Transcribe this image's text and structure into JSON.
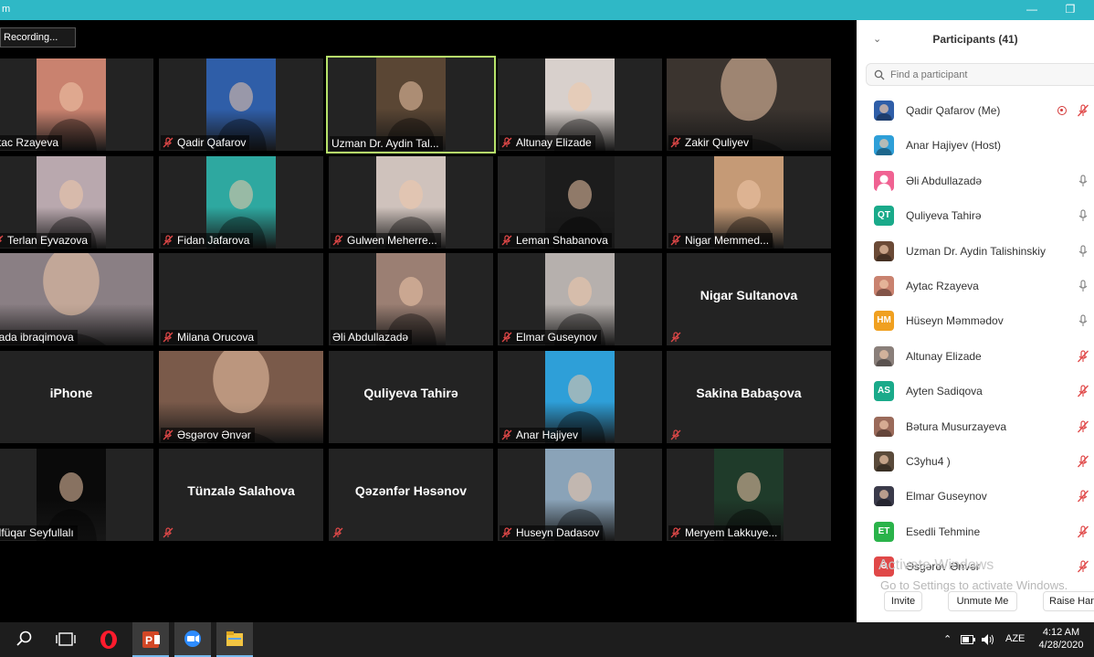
{
  "titlebar": {
    "title": "m",
    "minimize": "—",
    "restore": "❐"
  },
  "recording": {
    "label": "Recording..."
  },
  "tiles": [
    {
      "name": "ytac Rzayeva",
      "kind": "photo",
      "muted": false,
      "bg": "#c9826f"
    },
    {
      "name": "Qadir Qafarov",
      "kind": "photo",
      "muted": true,
      "bg": "#2f5ea8"
    },
    {
      "name": "Uzman Dr. Aydin Tal...",
      "kind": "photo",
      "muted": false,
      "bg": "#5a4634",
      "active": true
    },
    {
      "name": "Altunay Elizade",
      "kind": "photo",
      "muted": true,
      "bg": "#d8d0cc"
    },
    {
      "name": "Zakir Quliyev",
      "kind": "photofull",
      "muted": true,
      "bg": "#3b342f"
    },
    {
      "name": "Terlan Eyvazova",
      "kind": "photo",
      "muted": true,
      "bg": "#b9a8ae"
    },
    {
      "name": "Fidan Jafarova",
      "kind": "photo",
      "muted": true,
      "bg": "#2ea8a0"
    },
    {
      "name": "Gulwen Meherre...",
      "kind": "photo",
      "muted": true,
      "bg": "#cfc2bc"
    },
    {
      "name": "Leman Shabanova",
      "kind": "photo",
      "muted": true,
      "bg": "#1c1c1c"
    },
    {
      "name": "Nigar Memmed...",
      "kind": "photo",
      "muted": true,
      "bg": "#c59a76"
    },
    {
      "name": "irada ibraqimova",
      "kind": "photofull",
      "muted": false,
      "bg": "#8a7f84"
    },
    {
      "name": "Milana Orucova",
      "kind": "blank",
      "muted": true,
      "bg": "#000000"
    },
    {
      "name": "Əli Abdullazadə",
      "kind": "photo",
      "muted": false,
      "bg": "#9b7f73"
    },
    {
      "name": "Elmar Guseynov",
      "kind": "photo",
      "muted": true,
      "bg": "#b6b0ad"
    },
    {
      "name": "Nigar Sultanova",
      "kind": "text",
      "muted": true,
      "bg": "#232323"
    },
    {
      "name": "iPhone",
      "kind": "text",
      "muted": false,
      "bg": "#232323"
    },
    {
      "name": "Əsgərov Ənvər",
      "kind": "photofull",
      "muted": true,
      "bg": "#7a5a4a"
    },
    {
      "name": "Quliyeva Tahirə",
      "kind": "text",
      "muted": false,
      "bg": "#232323"
    },
    {
      "name": "Anar Hajiyev",
      "kind": "photo",
      "muted": true,
      "bg": "#2e9fd8"
    },
    {
      "name": "Sakina Babaşova",
      "kind": "text",
      "muted": true,
      "bg": "#232323"
    },
    {
      "name": "ülfüqar Seyfullalı",
      "kind": "photo",
      "muted": false,
      "bg": "#0a0a0a"
    },
    {
      "name": "Tünzalə Salahova",
      "kind": "text",
      "muted": true,
      "bg": "#232323"
    },
    {
      "name": "Qəzənfər Həsənov",
      "kind": "text",
      "muted": true,
      "bg": "#232323"
    },
    {
      "name": "Huseyn Dadasov",
      "kind": "photo",
      "muted": true,
      "bg": "#8aa3b8"
    },
    {
      "name": "Meryem Lakkuye...",
      "kind": "photo",
      "muted": true,
      "bg": "#1f3b2a"
    }
  ],
  "tile_labels": {
    "t14": "Nigar Sultanova",
    "t15": "iPhone",
    "t17": "Quliyeva Tahirə",
    "t19": "Sakina Babaşova",
    "t21": "Tünzalə Salahova",
    "t22": "Qəzənfər Həsənov"
  },
  "panel": {
    "title": "Participants (41)",
    "search_placeholder": "Find a participant",
    "participants": [
      {
        "name": "Qadir Qafarov (Me)",
        "avatar": "photo",
        "color": "#2f5ea8",
        "mic": "muted",
        "recording": true
      },
      {
        "name": "Anar Hajiyev (Host)",
        "avatar": "photo",
        "color": "#2e9fd8",
        "mic": "none"
      },
      {
        "name": "Əli Abdullazadə",
        "avatar": "default",
        "color": "#f06292",
        "mic": "on"
      },
      {
        "name": "Quliyeva Tahirə",
        "avatar": "QT",
        "color": "#1aaa8a",
        "mic": "on"
      },
      {
        "name": "Uzman Dr. Aydin Talishinskiy",
        "avatar": "photo",
        "color": "#6b4a36",
        "mic": "on"
      },
      {
        "name": "Aytac Rzayeva",
        "avatar": "photo",
        "color": "#c9826f",
        "mic": "on"
      },
      {
        "name": "Hüseyn Məmmədov",
        "avatar": "HM",
        "color": "#f0a020",
        "mic": "on"
      },
      {
        "name": "Altunay Elizade",
        "avatar": "photo",
        "color": "#8a7f7a",
        "mic": "muted"
      },
      {
        "name": "Ayten Sadiqova",
        "avatar": "AS",
        "color": "#1aaa8a",
        "mic": "muted"
      },
      {
        "name": "Bətura Musurzayeva",
        "avatar": "photo",
        "color": "#9a6a5a",
        "mic": "muted"
      },
      {
        "name": "C3yhu4 )",
        "avatar": "photo",
        "color": "#5a4a3a",
        "mic": "muted"
      },
      {
        "name": "Elmar Guseynov",
        "avatar": "photo",
        "color": "#3a3a4a",
        "mic": "muted"
      },
      {
        "name": "Esedli Tehmine",
        "avatar": "ET",
        "color": "#2ab34a",
        "mic": "muted"
      },
      {
        "name": "Əsgərov Ənvər",
        "avatar": "Ə",
        "color": "#e04848",
        "mic": "muted"
      }
    ],
    "watermark_title": "Activate Windows",
    "watermark_sub": "Go to Settings to activate Windows.",
    "buttons": {
      "invite": "Invite",
      "unmute": "Unmute Me",
      "raise": "Raise Hand"
    }
  },
  "taskbar": {
    "lang": "AZE",
    "time": "4:12 AM",
    "date": "4/28/2020",
    "apps": [
      "search-icon",
      "task-view-icon",
      "opera-icon",
      "powerpoint-icon",
      "zoom-icon",
      "file-explorer-icon"
    ]
  }
}
